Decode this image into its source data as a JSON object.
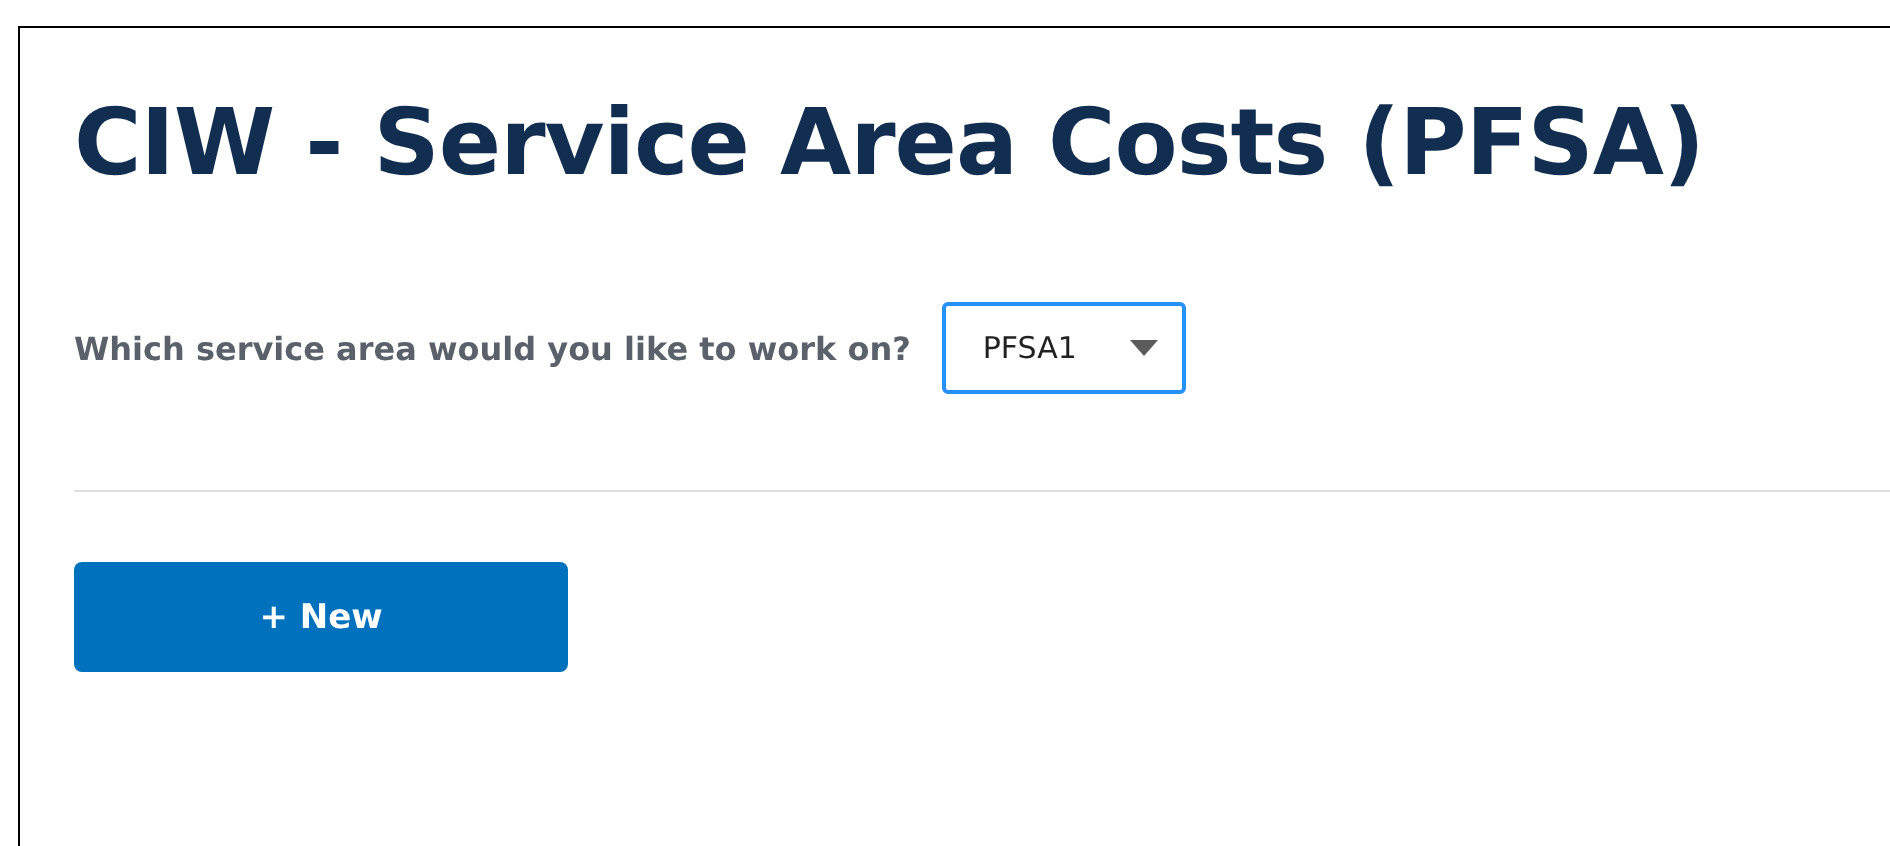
{
  "title": "CIW - Service Area Costs (PFSA)",
  "service_area": {
    "label": "Which service area would you like to work on?",
    "value": "PFSA1",
    "focused": true
  },
  "buttons": [
    {
      "label": "+ New",
      "kind": "primary"
    }
  ]
}
